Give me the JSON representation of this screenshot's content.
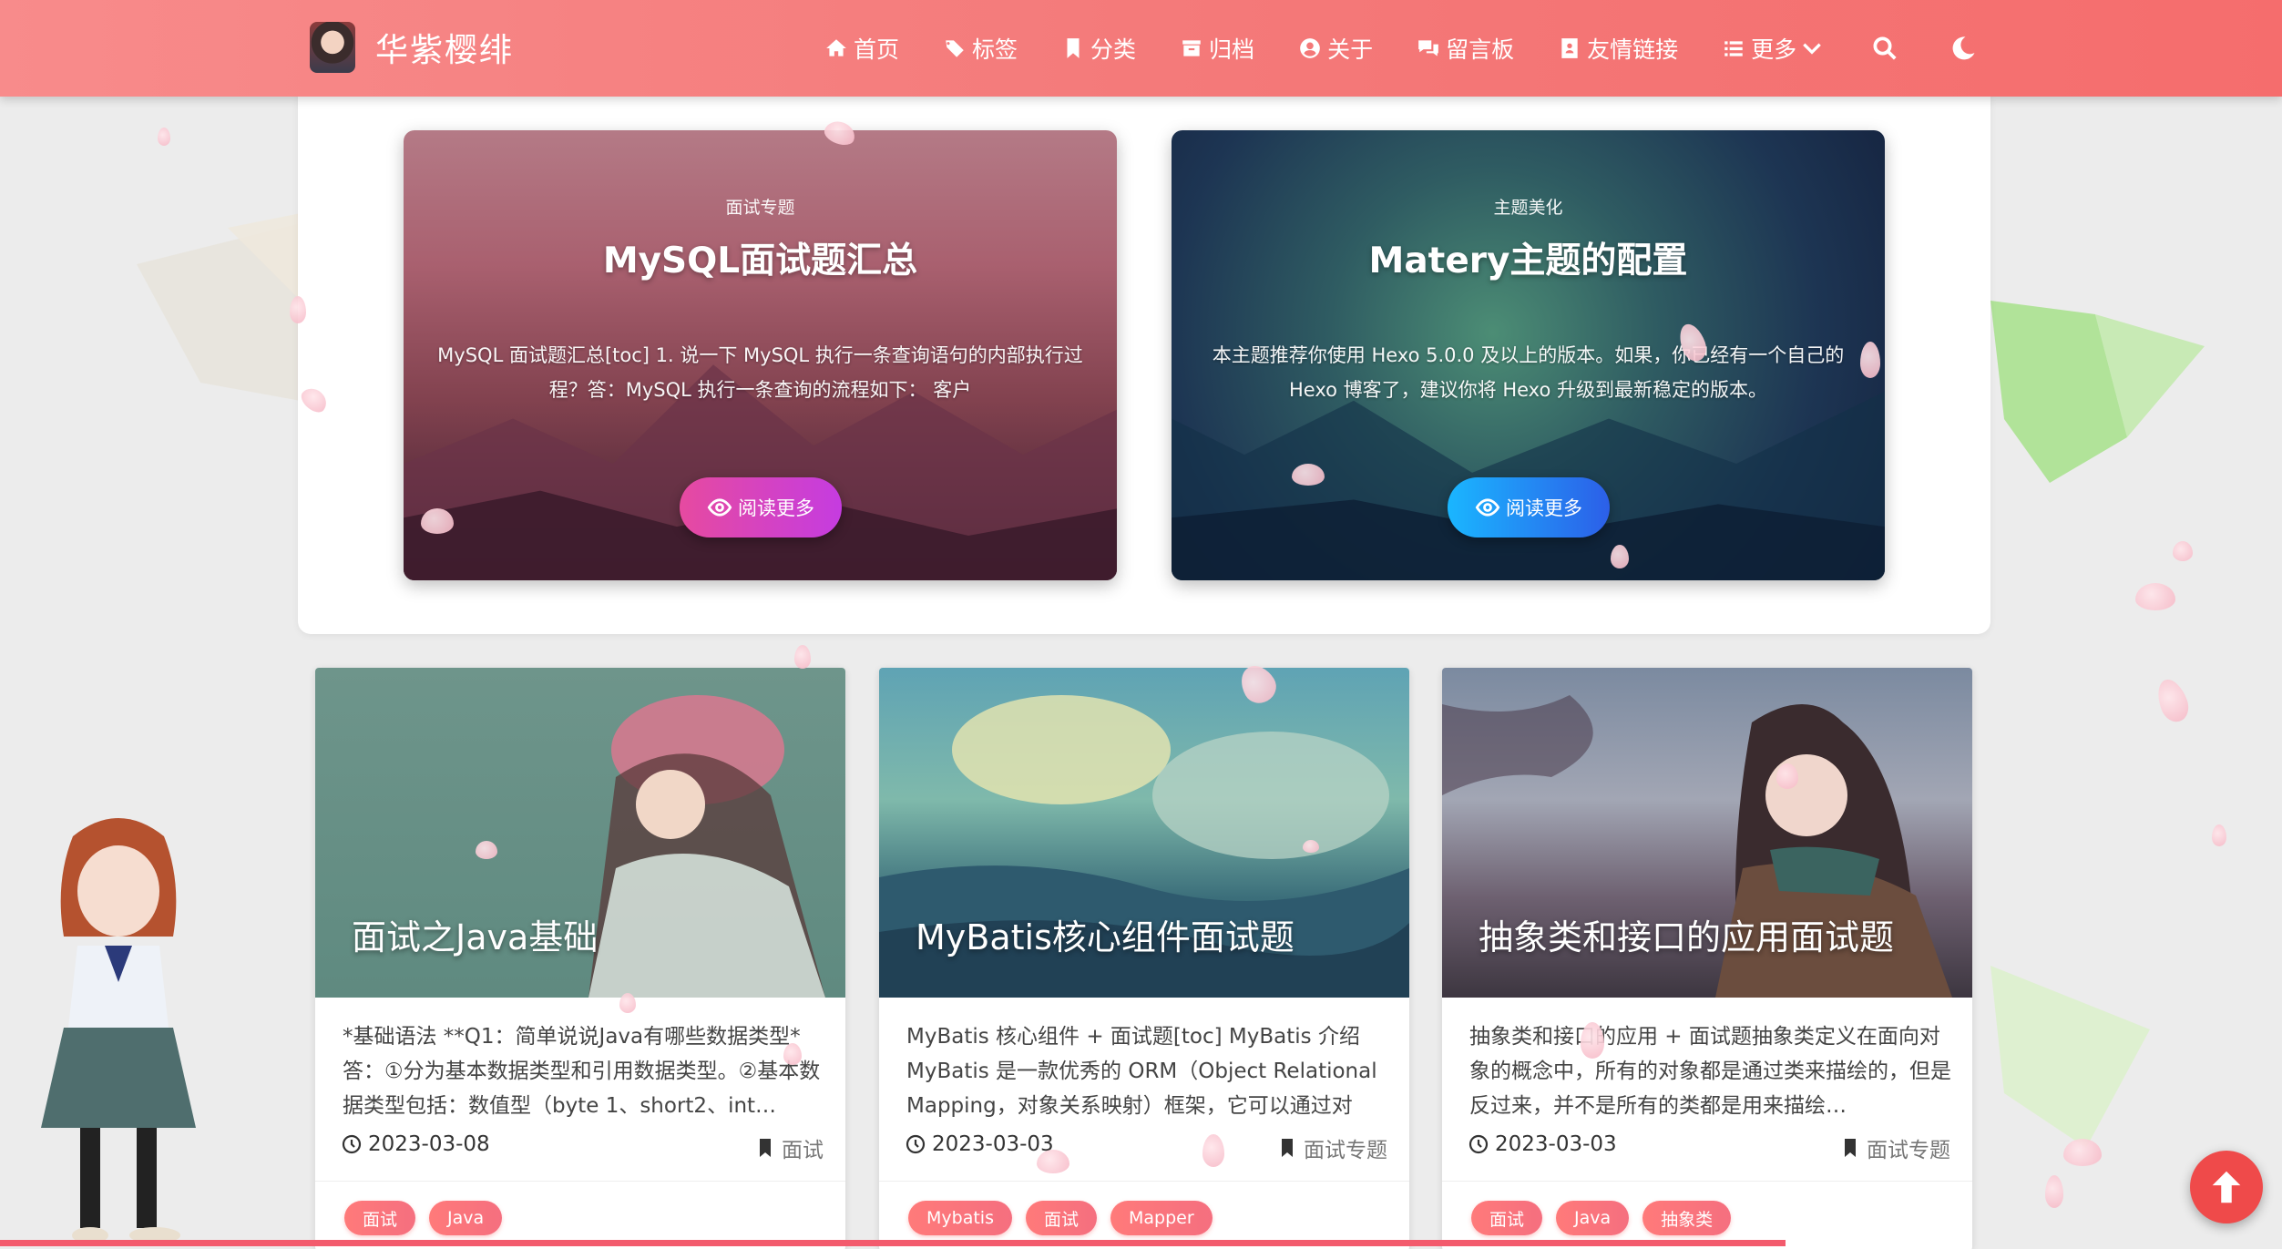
{
  "header": {
    "site_title": "华紫樱绯",
    "nav": [
      {
        "label": "首页",
        "icon": "home-icon"
      },
      {
        "label": "标签",
        "icon": "tags-icon"
      },
      {
        "label": "分类",
        "icon": "bookmark-icon"
      },
      {
        "label": "归档",
        "icon": "archive-icon"
      },
      {
        "label": "关于",
        "icon": "user-circle-icon"
      },
      {
        "label": "留言板",
        "icon": "comments-icon"
      },
      {
        "label": "友情链接",
        "icon": "address-book-icon"
      },
      {
        "label": "更多",
        "icon": "list-icon"
      }
    ],
    "search_icon": "search-icon",
    "theme_icon": "moon-icon"
  },
  "featured": [
    {
      "category": "面试专题",
      "title": "MySQL面试题汇总",
      "summary": "MySQL 面试题汇总[toc] 1. 说一下 MySQL 执行一条查询语句的内部执行过程？答：MySQL 执行一条查询的流程如下： 客户",
      "button": "阅读更多"
    },
    {
      "category": "主题美化",
      "title": "Matery主题的配置",
      "summary": "本主题推荐你使用 Hexo 5.0.0 及以上的版本。如果，你已经有一个自己的 Hexo 博客了，建议你将 Hexo 升级到最新稳定的版本。",
      "button": "阅读更多"
    }
  ],
  "posts": [
    {
      "image_title": "面试之Java基础",
      "summary": "*基础语法 **Q1：简单说说Java有哪些数据类型* 答：①分为基本数据类型和引用数据类型。②基本数据类型包括：数值型（byte 1、short2、int…",
      "date": "2023-03-08",
      "category": "面试",
      "tags": [
        "面试",
        "Java"
      ]
    },
    {
      "image_title": "MyBatis核心组件面试题",
      "summary": "MyBatis 核心组件 + 面试题[toc] MyBatis 介绍MyBatis 是一款优秀的 ORM（Object Relational Mapping，对象关系映射）框架，它可以通过对象…",
      "date": "2023-03-03",
      "category": "面试专题",
      "tags": [
        "Mybatis",
        "面试",
        "Mapper"
      ]
    },
    {
      "image_title": "抽象类和接口的应用面试题",
      "summary": "抽象类和接口的应用 + 面试题抽象类定义在面向对象的概念中，所有的对象都是通过类来描绘的，但是反过来，并不是所有的类都是用来描绘…",
      "date": "2023-03-03",
      "category": "面试专题",
      "tags": [
        "面试",
        "Java",
        "抽象类"
      ]
    }
  ],
  "colors": {
    "header_accent": "#f47a7a",
    "tag": "#f56f7f",
    "back_to_top": "#ef4a4a"
  },
  "back_to_top_icon": "arrow-up-icon"
}
